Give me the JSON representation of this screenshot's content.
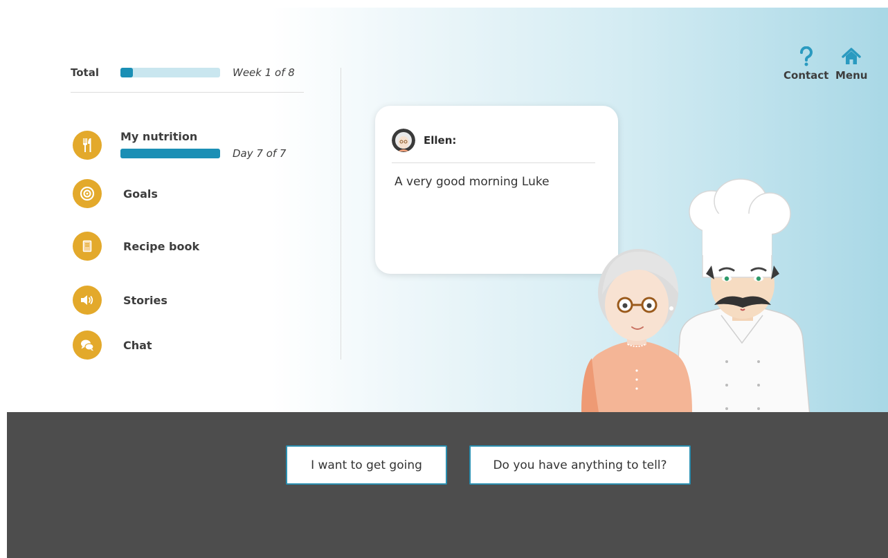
{
  "progress": {
    "total_label": "Total",
    "total_text": "Week 1 of 8",
    "total_fraction": 0.125
  },
  "nav": {
    "items": [
      {
        "label": "My nutrition",
        "icon": "cutlery-icon",
        "progress_text": "Day 7 of 7",
        "progress_fraction": 1.0
      },
      {
        "label": "Goals",
        "icon": "target-icon"
      },
      {
        "label": "Recipe book",
        "icon": "book-icon"
      },
      {
        "label": "Stories",
        "icon": "speaker-icon"
      },
      {
        "label": "Chat",
        "icon": "chat-bubbles-icon"
      }
    ]
  },
  "header": {
    "contact_label": "Contact",
    "contact_icon": "question-mark-icon",
    "menu_label": "Menu",
    "menu_icon": "home-icon"
  },
  "bubble": {
    "speaker": "Ellen:",
    "message": "A very good morning Luke"
  },
  "replies": [
    {
      "label": "I want to get going"
    },
    {
      "label": "Do you have anything to tell?"
    }
  ],
  "colors": {
    "accent_blue": "#1b8fb5",
    "icon_gold": "#e3a92b",
    "bottom_panel": "#4d4d4d"
  }
}
